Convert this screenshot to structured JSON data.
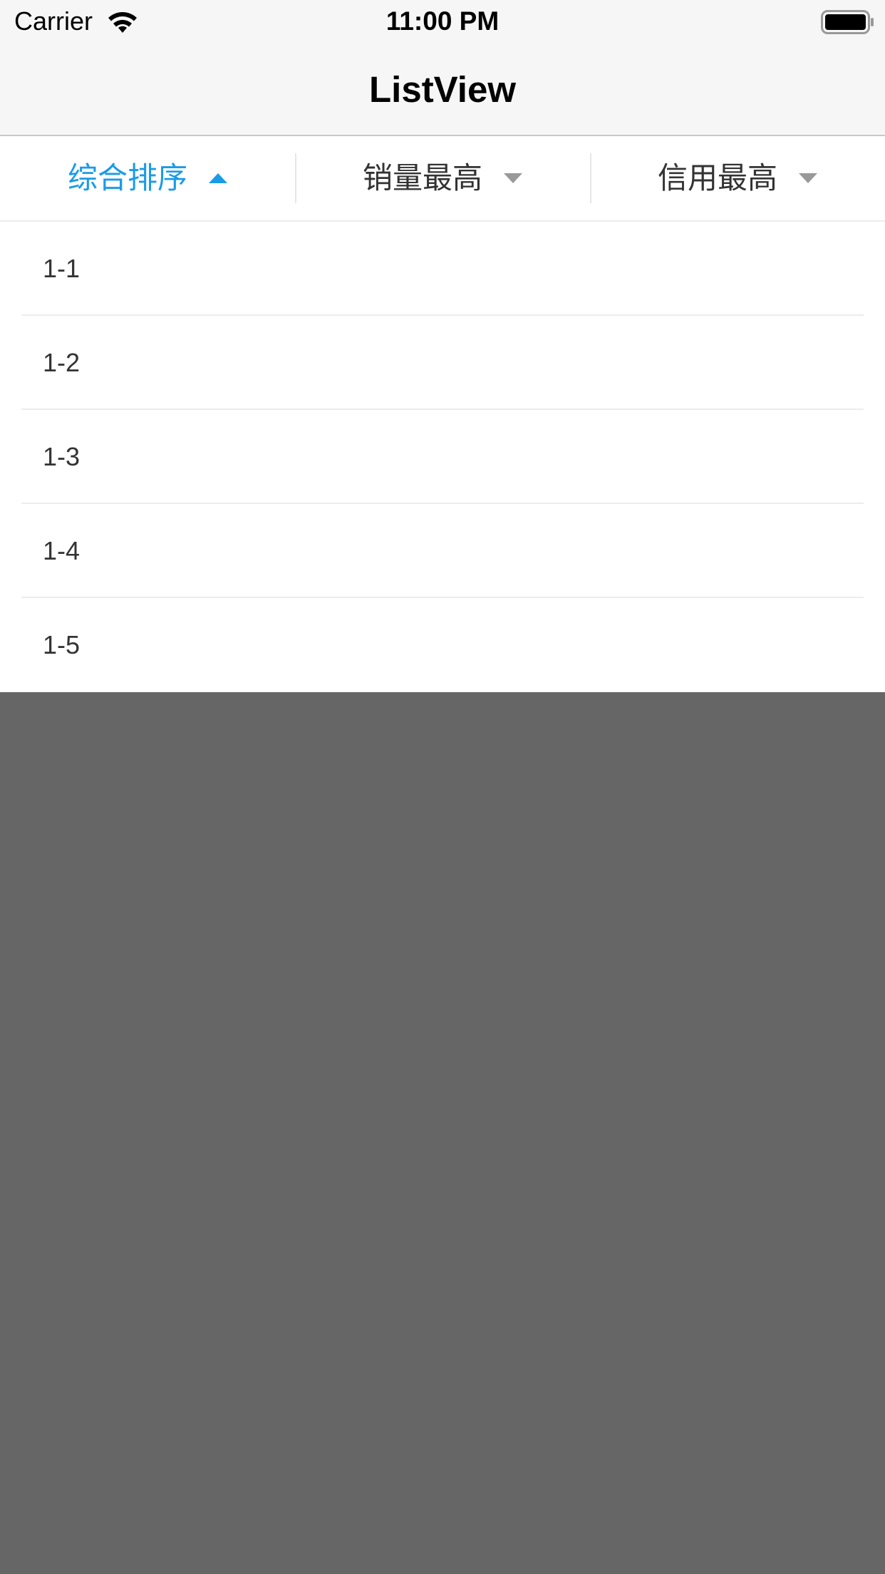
{
  "status_bar": {
    "carrier": "Carrier",
    "time": "11:00 PM",
    "wifi_icon": "wifi-icon",
    "battery_icon": "battery-full-icon"
  },
  "nav": {
    "title": "ListView"
  },
  "filters": [
    {
      "label": "综合排序",
      "active": true,
      "arrow": "triangle-up-icon"
    },
    {
      "label": "销量最高",
      "active": false,
      "arrow": "triangle-down-icon"
    },
    {
      "label": "信用最高",
      "active": false,
      "arrow": "triangle-down-icon"
    }
  ],
  "list": {
    "items": [
      "1-1",
      "1-2",
      "1-3",
      "1-4",
      "1-5"
    ]
  },
  "colors": {
    "accent": "#1a9be8",
    "overlay": "#666666",
    "arrow_inactive": "#999999"
  }
}
